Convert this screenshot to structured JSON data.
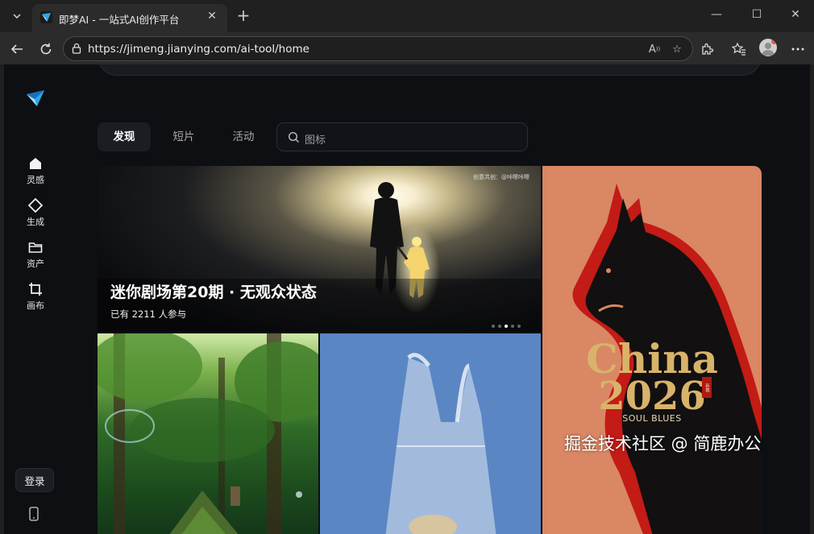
{
  "browser": {
    "tab_title": "即梦AI - 一站式AI创作平台",
    "url": "https://jimeng.jianying.com/ai-tool/home"
  },
  "sidebar": {
    "items": [
      {
        "label": "灵感",
        "icon": "home-icon"
      },
      {
        "label": "生成",
        "icon": "diamond-icon"
      },
      {
        "label": "资产",
        "icon": "folder-icon"
      },
      {
        "label": "画布",
        "icon": "canvas-crop-icon"
      }
    ],
    "login_label": "登录"
  },
  "tabs": [
    {
      "label": "发现",
      "active": true
    },
    {
      "label": "短片",
      "active": false
    },
    {
      "label": "活动",
      "active": false
    }
  ],
  "search": {
    "placeholder": "图标"
  },
  "hero": {
    "tag": "创意共创：@咔嚓咔嚓",
    "title": "迷你剧场第20期 · 无观众状态",
    "subtitle": "已有 2211 人参与",
    "carousel_count": 5,
    "carousel_active": 3
  },
  "poster": {
    "line1": "China",
    "line2": "2026",
    "subtitle": "SOUL BLUES",
    "seal": "新春"
  },
  "watermark": "掘金技术社区 @ 简鹿办公",
  "colors": {
    "page_bg": "#0e0f12",
    "accent": "#2aa8e6",
    "poster_bg": "#d98764"
  }
}
